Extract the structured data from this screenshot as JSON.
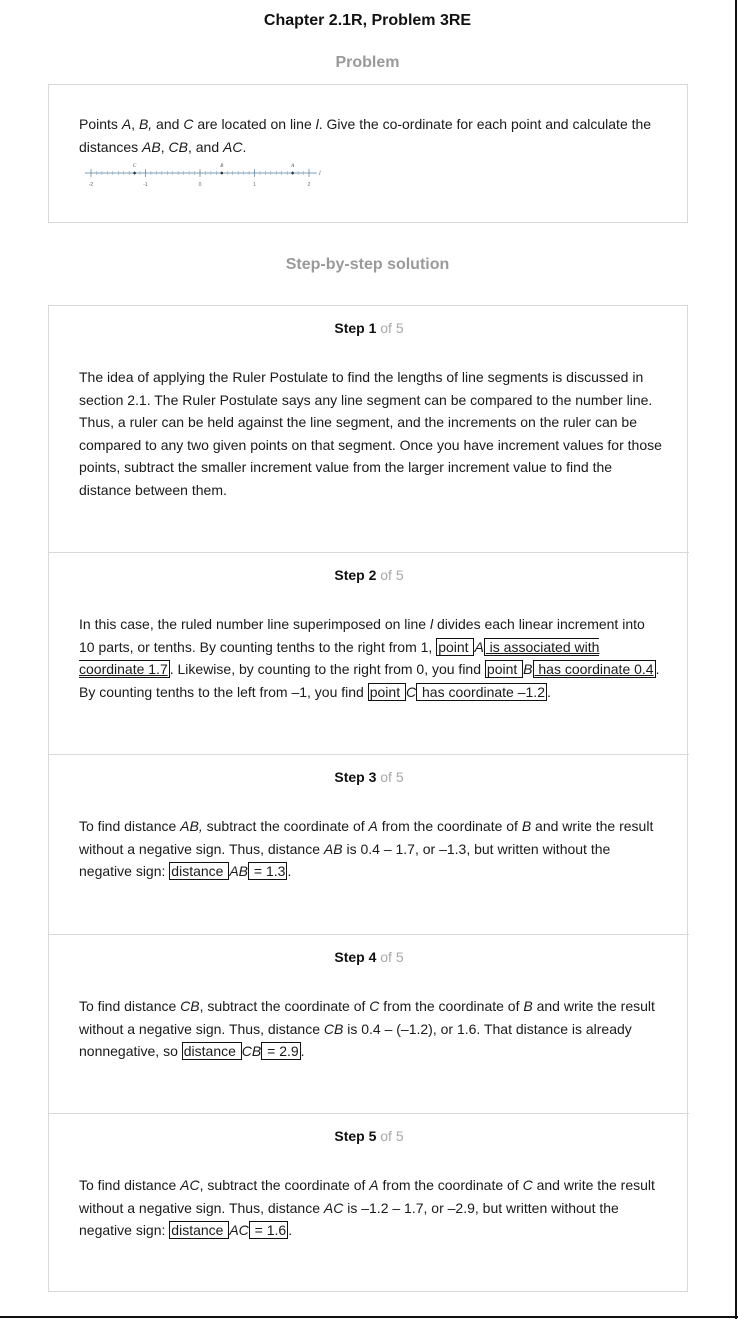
{
  "header": {
    "title": "Chapter 2.1R, Problem 3RE"
  },
  "problem": {
    "section_label": "Problem",
    "text": {
      "t1": "Points ",
      "A": "A",
      "t2": ", ",
      "B": "B,",
      "t3": " and ",
      "C": "C",
      "t4": " are located on line ",
      "l": "l",
      "t5": ". Give the co-ordinate for each point and calculate the distances ",
      "AB": "AB",
      "t6": ", ",
      "CB": "CB",
      "t7": ", and ",
      "AC": "AC",
      "t8": "."
    },
    "number_line": {
      "point_labels": [
        "C",
        "B",
        "A"
      ],
      "point_values": [
        -1.2,
        0.4,
        1.7
      ],
      "tick_labels": [
        "-2",
        "-1",
        "0",
        "1",
        "2"
      ],
      "range": [
        -2,
        2
      ],
      "line_label": "l"
    }
  },
  "solution": {
    "section_label": "Step-by-step solution",
    "steps": [
      {
        "head": "Step 1",
        "of": " of 5",
        "p": "The idea of applying the Ruler Postulate to find the lengths of line segments is discussed in section 2.1. The Ruler Postulate says any line segment can be compared to the number line. Thus, a ruler can be held against the line segment, and the increments on the ruler can be compared to any two given points on that segment. Once you have increment values for those points, subtract the smaller increment value from the larger increment value to find the distance between them."
      },
      {
        "head": "Step 2",
        "of": " of 5",
        "p": {
          "a": "In this case, the ruled number line superimposed on line ",
          "l": "l",
          "b": " divides each linear increment into 10 parts, or tenths. By counting tenths to the right from 1, ",
          "box1": "point ",
          "A": "A",
          "box2": " is associated with coordinate 1.7",
          "c": ". Likewise, by counting to the right from 0, you find ",
          "box3": "point ",
          "B": "B",
          "box4": " has coordinate 0.4",
          "d": ". By counting tenths to the left from –1, you find ",
          "box5": "point ",
          "C": "C",
          "box6": " has coordinate –1.2",
          "e": "."
        }
      },
      {
        "head": "Step 3",
        "of": " of 5",
        "p": {
          "a": "To find distance ",
          "AB1": "AB,",
          "b": " subtract the coordinate of ",
          "A": "A",
          "c": " from the coordinate of ",
          "B": "B",
          "d": " and write the result without a negative sign. Thus, distance ",
          "AB2": "AB",
          "e": " is 0.4 – 1.7, or –1.3, but written without the negative sign: ",
          "box1": "distance ",
          "AB3": "AB",
          "box2": " = 1.3",
          "f": "."
        }
      },
      {
        "head": "Step 4",
        "of": " of 5",
        "p": {
          "a": "To find distance ",
          "CB1": "CB",
          "b": ", subtract the coordinate of ",
          "C": "C",
          "c": " from the coordinate of ",
          "B": "B",
          "d": " and write the result without a negative sign. Thus, distance ",
          "CB2": "CB",
          "e": " is 0.4 – (–1.2), or 1.6. That distance is already nonnegative, so ",
          "box1": "distance ",
          "CB3": "CB",
          "box2": " = 2.9",
          "f": "."
        }
      },
      {
        "head": "Step 5",
        "of": " of 5",
        "p": {
          "a": "To find distance ",
          "AC1": "AC",
          "b": ", subtract the coordinate of ",
          "A": "A",
          "c": " from the coordinate of ",
          "C": "C",
          "d": " and write the result without a negative sign. Thus, distance ",
          "AC2": "AC",
          "e": " is –1.2 – 1.7, or –2.9, but written without the negative sign: ",
          "box1": "distance ",
          "AC3": "AC",
          "box2": " = 1.6",
          "f": "."
        }
      }
    ]
  }
}
